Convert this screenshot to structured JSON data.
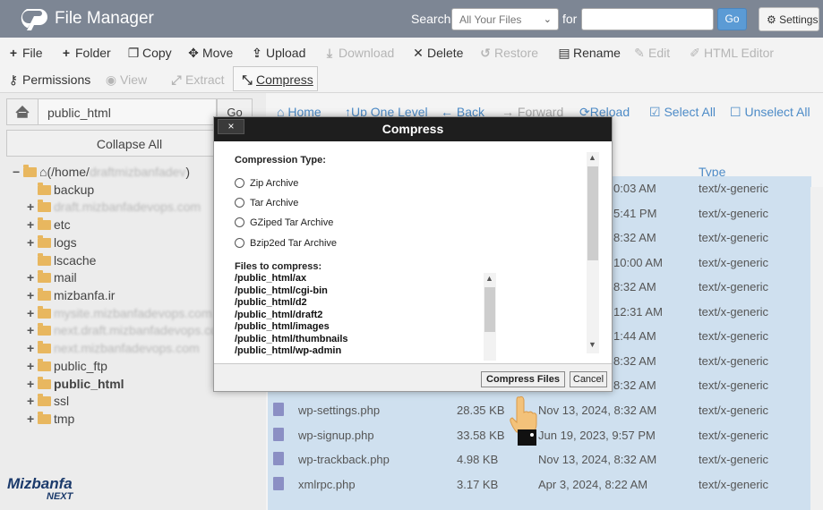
{
  "app": {
    "title": "File Manager"
  },
  "search": {
    "label": "Search",
    "scope": "All Your Files",
    "for_label": "for",
    "query": "",
    "go": "Go",
    "settings": "Settings"
  },
  "toolbar": [
    {
      "label": "File",
      "icon": "plus-icon",
      "enabled": true
    },
    {
      "label": "Folder",
      "icon": "plus-icon",
      "enabled": true
    },
    {
      "label": "Copy",
      "icon": "copy-icon",
      "enabled": true
    },
    {
      "label": "Move",
      "icon": "move-icon",
      "enabled": true
    },
    {
      "label": "Upload",
      "icon": "upload-icon",
      "enabled": true
    },
    {
      "label": "Download",
      "icon": "download-icon",
      "enabled": false
    },
    {
      "label": "Delete",
      "icon": "delete-icon",
      "enabled": true
    },
    {
      "label": "Restore",
      "icon": "restore-icon",
      "enabled": false
    },
    {
      "label": "Rename",
      "icon": "rename-icon",
      "enabled": true
    },
    {
      "label": "Edit",
      "icon": "edit-icon",
      "enabled": false
    },
    {
      "label": "HTML Editor",
      "icon": "html-editor-icon",
      "enabled": false
    },
    {
      "label": "Permissions",
      "icon": "key-icon",
      "enabled": true
    },
    {
      "label": "View",
      "icon": "eye-icon",
      "enabled": false
    },
    {
      "label": "Extract",
      "icon": "extract-icon",
      "enabled": false
    },
    {
      "label": "Compress",
      "icon": "compress-icon",
      "enabled": true
    }
  ],
  "left": {
    "path": "public_html",
    "go": "Go",
    "collapse_all": "Collapse All",
    "tree": [
      {
        "label": "(/home/draftmizbanfadev)",
        "blurred_part": "draftmizbanfadev",
        "type": "root"
      },
      {
        "label": "backup"
      },
      {
        "label": "draft.mizbanfadevops.com",
        "blurred": true
      },
      {
        "label": "etc"
      },
      {
        "label": "logs"
      },
      {
        "label": "lscache"
      },
      {
        "label": "mail"
      },
      {
        "label": "mizbanfa.ir"
      },
      {
        "label": "mysite.mizbanfadevops.com",
        "blurred": true
      },
      {
        "label": "next.draft.mizbanfadevops.com",
        "blurred": true
      },
      {
        "label": "next.mizbanfadevops.com",
        "blurred": true
      },
      {
        "label": "public_ftp"
      },
      {
        "label": "public_html",
        "bold": true
      },
      {
        "label": "ssl"
      },
      {
        "label": "tmp"
      }
    ]
  },
  "nav": {
    "home": "Home",
    "up": "Up One Level",
    "back": "Back",
    "forward": "Forward",
    "reload": "Reload",
    "select_all": "Select All",
    "unselect_all": "Unselect All"
  },
  "table": {
    "type_header": "Type",
    "rows": [
      {
        "name": "",
        "size": "",
        "date": "0:03 AM",
        "type": "text/x-generic"
      },
      {
        "name": "",
        "size": "",
        "date": "5:41 PM",
        "type": "text/x-generic"
      },
      {
        "name": "",
        "size": "",
        "date": "8:32 AM",
        "type": "text/x-generic"
      },
      {
        "name": "",
        "size": "",
        "date": "10:00 AM",
        "type": "text/x-generic"
      },
      {
        "name": "",
        "size": "",
        "date": "8:32 AM",
        "type": "text/x-generic"
      },
      {
        "name": "",
        "size": "",
        "date": "12:31 AM",
        "type": "text/x-generic"
      },
      {
        "name": "",
        "size": "",
        "date": "1:44 AM",
        "type": "text/x-generic"
      },
      {
        "name": "",
        "size": "",
        "date": "8:32 AM",
        "type": "text/x-generic"
      },
      {
        "name": "",
        "size": "",
        "date": "8:32 AM",
        "type": "text/x-generic"
      },
      {
        "name": "wp-settings.php",
        "size": "28.35 KB",
        "date": "Nov 13, 2024, 8:32 AM",
        "type": "text/x-generic"
      },
      {
        "name": "wp-signup.php",
        "size": "33.58 KB",
        "date": "Jun 19, 2023, 9:57 PM",
        "type": "text/x-generic"
      },
      {
        "name": "wp-trackback.php",
        "size": "4.98 KB",
        "date": "Nov 13, 2024, 8:32 AM",
        "type": "text/x-generic"
      },
      {
        "name": "xmlrpc.php",
        "size": "3.17 KB",
        "date": "Apr 3, 2024, 8:22 AM",
        "type": "text/x-generic"
      }
    ]
  },
  "modal": {
    "title": "Compress",
    "close": "×",
    "type_label": "Compression Type:",
    "options": [
      "Zip Archive",
      "Tar Archive",
      "GZiped Tar Archive",
      "Bzip2ed Tar Archive"
    ],
    "files_label": "Files to compress:",
    "files": [
      "/public_html/ax",
      "/public_html/cgi-bin",
      "/public_html/d2",
      "/public_html/draft2",
      "/public_html/images",
      "/public_html/thumbnails",
      "/public_html/wp-admin"
    ],
    "compress_button": "Compress Files",
    "cancel_button": "Cancel"
  },
  "brand": {
    "line1": "Mizbanfa",
    "line2": "NEXT"
  },
  "colors": {
    "topbar": "#7d8694",
    "accent": "#4d8bc7",
    "selected_rows": "#cfe0ef",
    "modal_header": "#1e1e1e"
  }
}
